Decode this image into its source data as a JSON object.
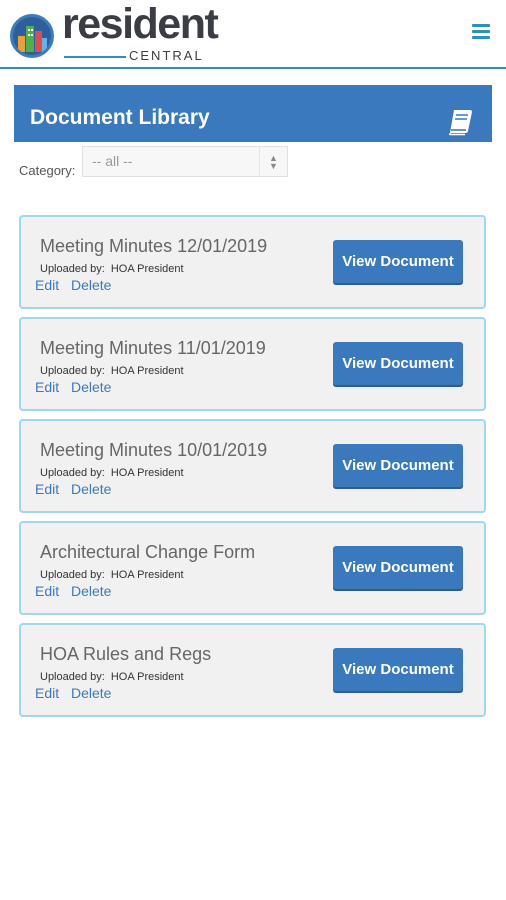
{
  "brand": {
    "name": "resident",
    "tagline": "CENTRAL",
    "accent_color": "#2c8fc2",
    "header_color": "#3a79bd"
  },
  "header": {
    "menu_icon": "hamburger-menu-icon"
  },
  "library": {
    "title": "Document Library",
    "icon": "book-icon"
  },
  "filter": {
    "label": "Category:",
    "selected": "-- all --"
  },
  "documents": [
    {
      "title": "Meeting Minutes 12/01/2019",
      "uploaded_label": "Uploaded by:",
      "uploader": "HOA President",
      "edit": "Edit",
      "delete": "Delete",
      "action": "View Document"
    },
    {
      "title": "Meeting Minutes 11/01/2019",
      "uploaded_label": "Uploaded by:",
      "uploader": "HOA President",
      "edit": "Edit",
      "delete": "Delete",
      "action": "View Document"
    },
    {
      "title": "Meeting Minutes 10/01/2019",
      "uploaded_label": "Uploaded by:",
      "uploader": "HOA President",
      "edit": "Edit",
      "delete": "Delete",
      "action": "View Document"
    },
    {
      "title": "Architectural Change Form",
      "uploaded_label": "Uploaded by:",
      "uploader": "HOA President",
      "edit": "Edit",
      "delete": "Delete",
      "action": "View Document"
    },
    {
      "title": "HOA Rules and Regs",
      "uploaded_label": "Uploaded by:",
      "uploader": "HOA President",
      "edit": "Edit",
      "delete": "Delete",
      "action": "View Document"
    }
  ]
}
